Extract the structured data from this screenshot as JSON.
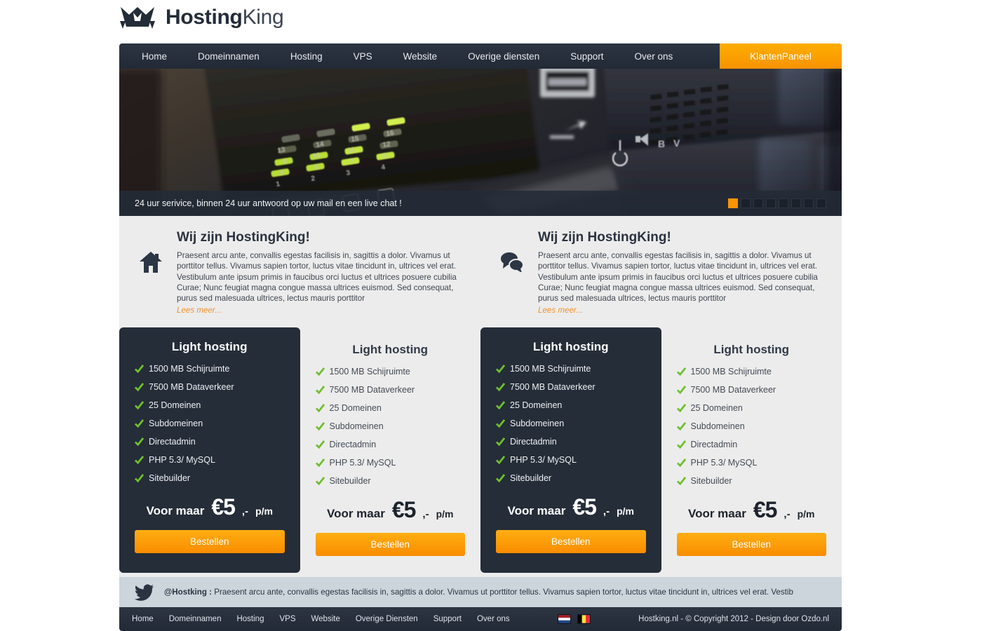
{
  "brand": {
    "logo_icon": "crown-king-icon",
    "name_bold": "Hosting",
    "name_light": "King"
  },
  "nav": {
    "items": [
      {
        "label": "Home"
      },
      {
        "label": "Domeinnamen"
      },
      {
        "label": "Hosting"
      },
      {
        "label": "VPS"
      },
      {
        "label": "Website"
      },
      {
        "label": "Overige diensten"
      },
      {
        "label": "Support"
      },
      {
        "label": "Over ons"
      }
    ],
    "cta_label": "KlantenPaneel",
    "cta_color": "#f79200"
  },
  "hero": {
    "image_description": "close-up of a dark rack server front panel with green port LEDs numbered 1 to 16, a USB port and ventilation grilles",
    "caption": "24 uur serivice, binnen 24 uur antwoord op uw mail en een live chat !",
    "slider_dots": 8,
    "active_dot": 1,
    "active_dot_color": "#f89406"
  },
  "intro": {
    "blocks": [
      {
        "icon": "home-icon",
        "title": "Wij zijn HostingKing!",
        "text": "Praesent arcu ante, convallis egestas facilisis in, sagittis a dolor. Vivamus ut porttitor tellus. Vivamus sapien tortor, luctus vitae tincidunt in, ultrices vel erat. Vestibulum ante ipsum primis in faucibus orci luctus et ultrices posuere cubilia Curae; Nunc feugiat magna congue massa ultrices euismod. Sed consequat, purus sed malesuada ultrices, lectus mauris porttitor",
        "more_label": "Lees meer..."
      },
      {
        "icon": "chat-bubbles-icon",
        "title": "Wij zijn HostingKing!",
        "text": "Praesent arcu ante, convallis egestas facilisis in, sagittis a dolor. Vivamus ut porttitor tellus. Vivamus sapien tortor, luctus vitae tincidunt in, ultrices vel erat. Vestibulum ante ipsum primis in faucibus orci luctus et ultrices posuere cubilia Curae; Nunc feugiat magna congue massa ultrices euismod. Sed consequat, purus sed malesuada ultrices, lectus mauris porttitor",
        "more_label": "Lees meer..."
      }
    ]
  },
  "pricing": {
    "check_icon": "green-check-icon",
    "check_color": "#6fbf2f",
    "cards": [
      {
        "theme": "dark",
        "title": "Light hosting",
        "features": [
          "1500 MB Schijruimte",
          "7500 MB Dataverkeer",
          "25 Domeinen",
          "Subdomeinen",
          "Directadmin",
          "PHP 5.3/ MySQL",
          "Sitebuilder"
        ],
        "price_lead": "Voor maar",
        "price_amount": "€5",
        "price_suffix": ",-",
        "price_period": "p/m",
        "button_label": "Bestellen"
      },
      {
        "theme": "light",
        "title": "Light hosting",
        "features": [
          "1500 MB Schijruimte",
          "7500 MB Dataverkeer",
          "25 Domeinen",
          "Subdomeinen",
          "Directadmin",
          "PHP 5.3/ MySQL",
          "Sitebuilder"
        ],
        "price_lead": "Voor maar",
        "price_amount": "€5",
        "price_suffix": ",-",
        "price_period": "p/m",
        "button_label": "Bestellen"
      },
      {
        "theme": "dark",
        "title": "Light hosting",
        "features": [
          "1500 MB Schijruimte",
          "7500 MB Dataverkeer",
          "25 Domeinen",
          "Subdomeinen",
          "Directadmin",
          "PHP 5.3/ MySQL",
          "Sitebuilder"
        ],
        "price_lead": "Voor maar",
        "price_amount": "€5",
        "price_suffix": ",-",
        "price_period": "p/m",
        "button_label": "Bestellen"
      },
      {
        "theme": "light",
        "title": "Light hosting",
        "features": [
          "1500 MB Schijruimte",
          "7500 MB Dataverkeer",
          "25 Domeinen",
          "Subdomeinen",
          "Directadmin",
          "PHP 5.3/ MySQL",
          "Sitebuilder"
        ],
        "price_lead": "Voor maar",
        "price_amount": "€5",
        "price_suffix": ",-",
        "price_period": "p/m",
        "button_label": "Bestellen"
      }
    ]
  },
  "twitter": {
    "icon": "twitter-bird-icon",
    "handle": "@Hostking :",
    "message": "Praesent arcu ante, convallis egestas facilisis in, sagittis a dolor. Vivamus ut porttitor tellus. Vivamus sapien tortor, luctus vitae tincidunt in, ultrices vel erat. Vestib"
  },
  "footer": {
    "links": [
      {
        "label": "Home"
      },
      {
        "label": "Domeinnamen"
      },
      {
        "label": "Hosting"
      },
      {
        "label": "VPS"
      },
      {
        "label": "Website"
      },
      {
        "label": "Overige Diensten"
      },
      {
        "label": "Support"
      },
      {
        "label": "Over ons"
      }
    ],
    "flags": [
      {
        "name": "flag-netherlands"
      },
      {
        "name": "flag-belgium"
      }
    ],
    "copyright": "Hostking.nl - © Copyright 2012 - Design door Ozdo.nl"
  }
}
